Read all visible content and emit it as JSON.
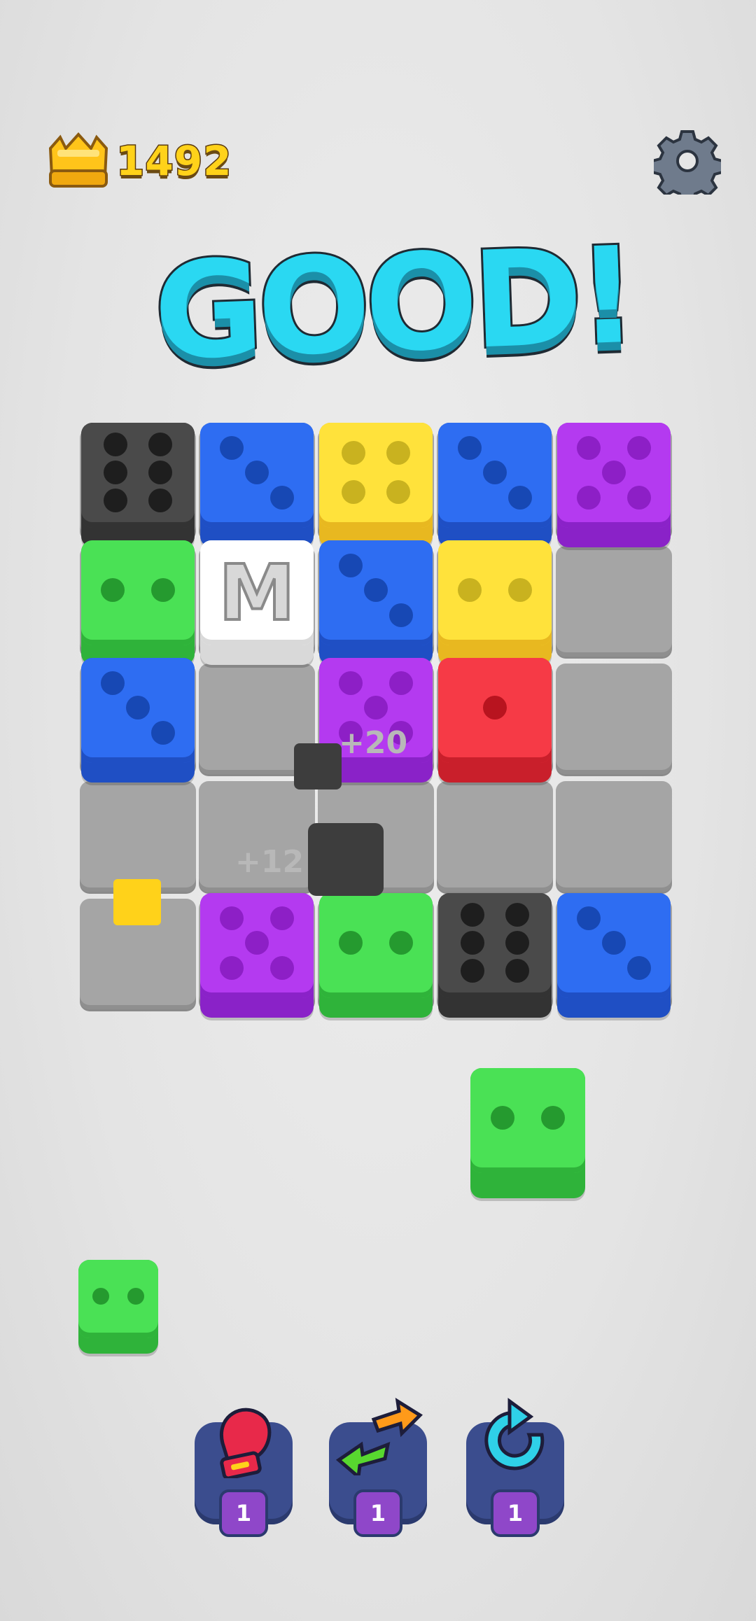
{
  "header": {
    "coins": "1492",
    "settings_icon": "gear-icon",
    "crown_icon": "crown-icon"
  },
  "banner": {
    "text": "GOOD!"
  },
  "board": {
    "rows": 5,
    "cols": 5,
    "tiles": [
      {
        "row": 0,
        "col": 0,
        "color": "black",
        "value": 6
      },
      {
        "row": 0,
        "col": 1,
        "color": "blue",
        "value": 3
      },
      {
        "row": 0,
        "col": 2,
        "color": "yellow",
        "value": 4
      },
      {
        "row": 0,
        "col": 3,
        "color": "blue",
        "value": 3
      },
      {
        "row": 0,
        "col": 4,
        "color": "purple",
        "value": 5
      },
      {
        "row": 1,
        "col": 0,
        "color": "green",
        "value": 2
      },
      {
        "row": 1,
        "col": 1,
        "color": "white",
        "label": "M"
      },
      {
        "row": 1,
        "col": 2,
        "color": "blue",
        "value": 3
      },
      {
        "row": 1,
        "col": 3,
        "color": "yellow",
        "value": 2
      },
      {
        "row": 2,
        "col": 0,
        "color": "blue",
        "value": 3
      },
      {
        "row": 2,
        "col": 2,
        "color": "purple",
        "value": 5
      },
      {
        "row": 2,
        "col": 3,
        "color": "red",
        "value": 1
      },
      {
        "row": 4,
        "col": 1,
        "color": "purple",
        "value": 5
      },
      {
        "row": 4,
        "col": 2,
        "color": "green",
        "value": 2
      },
      {
        "row": 4,
        "col": 3,
        "color": "black",
        "value": 6
      },
      {
        "row": 4,
        "col": 4,
        "color": "blue",
        "value": 3
      }
    ],
    "ghost_scores": [
      "+20",
      "+12"
    ]
  },
  "tray": {
    "next_tile": {
      "color": "green",
      "value": 2
    },
    "small_tile": {
      "color": "green",
      "value": 2
    }
  },
  "boosters": [
    {
      "name": "boxing-glove",
      "icon": "boxing-glove-icon",
      "count": "1"
    },
    {
      "name": "swap",
      "icon": "swap-arrows-icon",
      "count": "1"
    },
    {
      "name": "refresh",
      "icon": "refresh-icon",
      "count": "1"
    }
  ],
  "colors": {
    "black": {
      "top": "#4a4a4a",
      "side": "#333333",
      "pip": "#1e1e1e"
    },
    "blue": {
      "top": "#2e6df2",
      "side": "#1f4fc4",
      "pip": "#1748b4"
    },
    "yellow": {
      "top": "#ffe23b",
      "side": "#e8b820",
      "pip": "#c9b21f"
    },
    "purple": {
      "top": "#b43af0",
      "side": "#8a22c8",
      "pip": "#8d1fc6"
    },
    "green": {
      "top": "#4ae155",
      "side": "#2fb33a",
      "pip": "#259a2f"
    },
    "red": {
      "top": "#f63a46",
      "side": "#c91f2b",
      "pip": "#b8141f"
    },
    "white": {
      "top": "#ffffff",
      "side": "#d9d9d9",
      "pip": "#9a9a9a"
    }
  }
}
